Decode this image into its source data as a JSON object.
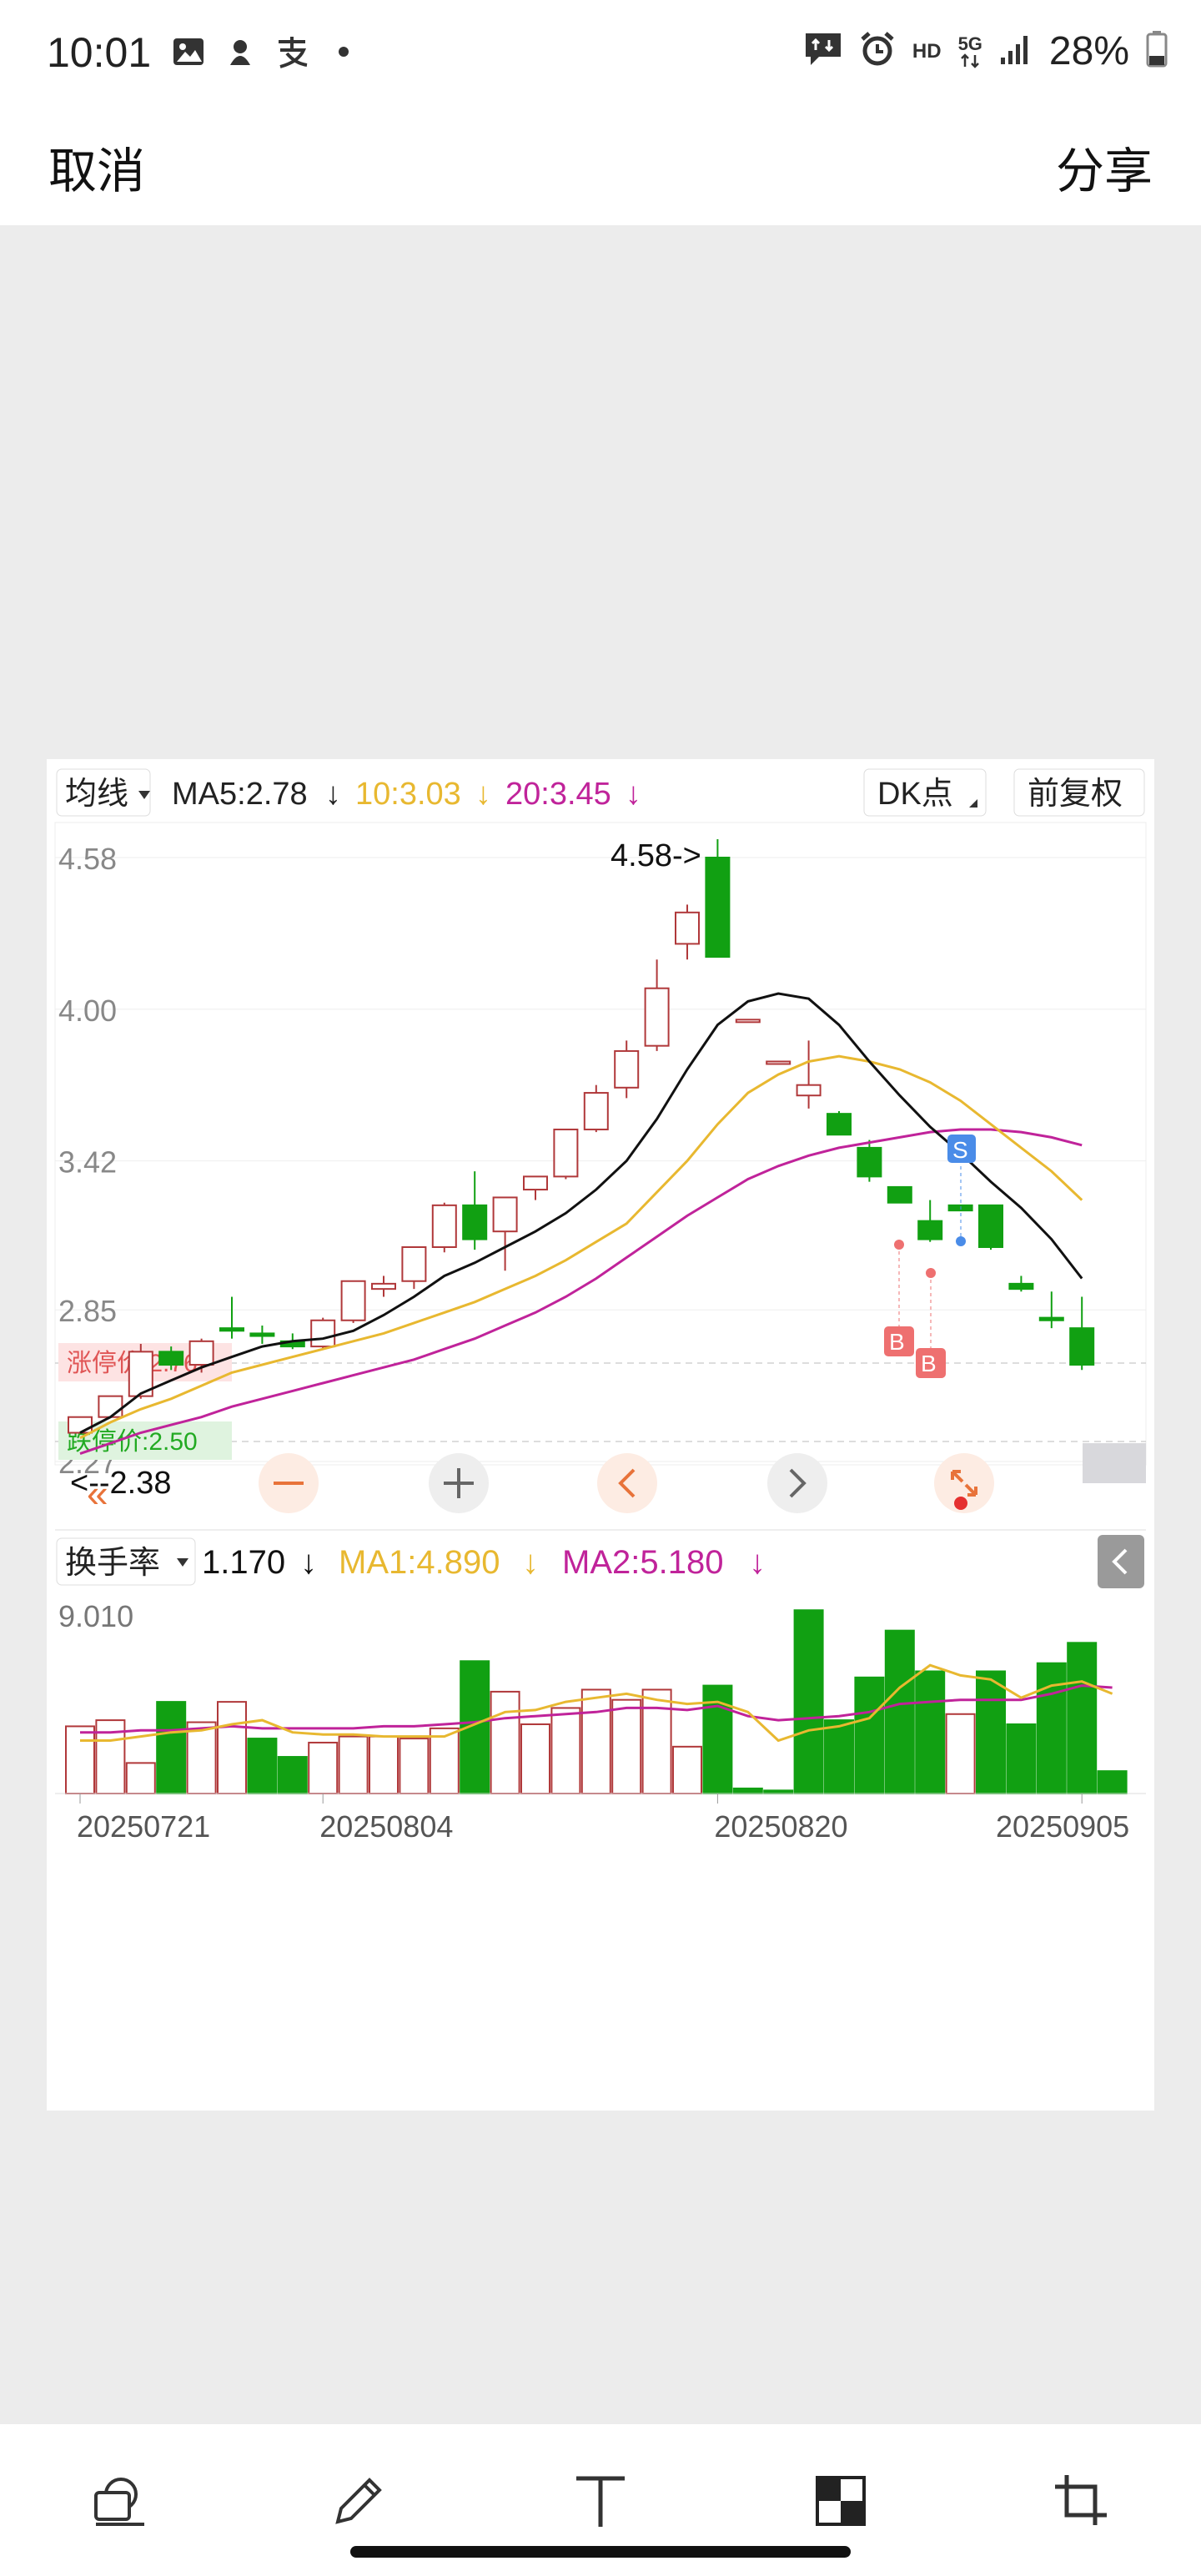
{
  "status_bar": {
    "time": "10:01",
    "network": "5G",
    "hd": "HD",
    "battery": "28%",
    "icons": [
      "gallery-icon",
      "app-icon",
      "alipay-icon",
      "dot-icon",
      "message-icon",
      "alarm-icon",
      "signal-icon",
      "battery-icon"
    ]
  },
  "header": {
    "cancel_label": "取消",
    "share_label": "分享"
  },
  "chart": {
    "indicator_bar": {
      "type_label": "均线",
      "ma5": "MA5:2.78",
      "ma10": "10:3.03",
      "ma20": "20:3.45",
      "arrow": "↓",
      "dk_label": "DK点",
      "adj_label": "前复权"
    },
    "price_labels": [
      "4.58",
      "4.00",
      "3.42",
      "2.85",
      "2.27"
    ],
    "high_marker": "4.58->",
    "low_marker": "<--2.38",
    "limit_up": "涨停价:2.76",
    "limit_down": "跌停价:2.50",
    "marker_s": "S",
    "marker_b": "B",
    "volume_bar": {
      "type_label": "换手率",
      "value": "1.170",
      "ma1": "MA1:4.890",
      "ma2": "MA2:5.180",
      "arrow": "↓"
    },
    "vol_max_label": "9.010",
    "date_labels": [
      "20250721",
      "20250804",
      "20250820",
      "20250905"
    ],
    "colors": {
      "up": "#b0383a",
      "down": "#11a012",
      "ma5": "#111111",
      "ma10": "#e8b830",
      "ma20": "#c0239a",
      "limit_up": "#e05555",
      "limit_down": "#22aa22",
      "nav": "#e8733a",
      "marker_s": "#4a8ce8",
      "marker_b": "#ee7070"
    }
  },
  "chart_data": {
    "type": "candlestick",
    "price_axis": [
      2.27,
      4.58
    ],
    "dates": [
      "20250721",
      "20250804",
      "20250820",
      "20250905"
    ],
    "candles": [
      {
        "o": 2.38,
        "h": 2.44,
        "l": 2.38,
        "c": 2.44
      },
      {
        "o": 2.44,
        "h": 2.52,
        "l": 2.44,
        "c": 2.52
      },
      {
        "o": 2.52,
        "h": 2.72,
        "l": 2.51,
        "c": 2.69
      },
      {
        "o": 2.69,
        "h": 2.71,
        "l": 2.62,
        "c": 2.64
      },
      {
        "o": 2.64,
        "h": 2.74,
        "l": 2.61,
        "c": 2.73
      },
      {
        "o": 2.78,
        "h": 2.9,
        "l": 2.74,
        "c": 2.77
      },
      {
        "o": 2.76,
        "h": 2.79,
        "l": 2.72,
        "c": 2.75
      },
      {
        "o": 2.73,
        "h": 2.76,
        "l": 2.7,
        "c": 2.71
      },
      {
        "o": 2.71,
        "h": 2.82,
        "l": 2.7,
        "c": 2.81
      },
      {
        "o": 2.81,
        "h": 2.96,
        "l": 2.8,
        "c": 2.96
      },
      {
        "o": 2.93,
        "h": 2.98,
        "l": 2.9,
        "c": 2.95
      },
      {
        "o": 2.96,
        "h": 3.09,
        "l": 2.93,
        "c": 3.09
      },
      {
        "o": 3.09,
        "h": 3.26,
        "l": 3.07,
        "c": 3.25
      },
      {
        "o": 3.25,
        "h": 3.38,
        "l": 3.08,
        "c": 3.12
      },
      {
        "o": 3.15,
        "h": 3.28,
        "l": 3.0,
        "c": 3.28
      },
      {
        "o": 3.31,
        "h": 3.36,
        "l": 3.27,
        "c": 3.36
      },
      {
        "o": 3.36,
        "h": 3.54,
        "l": 3.35,
        "c": 3.54
      },
      {
        "o": 3.54,
        "h": 3.71,
        "l": 3.53,
        "c": 3.68
      },
      {
        "o": 3.7,
        "h": 3.88,
        "l": 3.66,
        "c": 3.84
      },
      {
        "o": 3.86,
        "h": 4.19,
        "l": 3.84,
        "c": 4.08
      },
      {
        "o": 4.25,
        "h": 4.4,
        "l": 4.19,
        "c": 4.37
      },
      {
        "o": 4.58,
        "h": 4.65,
        "l": 4.2,
        "c": 4.2
      },
      {
        "o": 3.96,
        "h": 3.96,
        "l": 3.96,
        "c": 3.96
      },
      {
        "o": 3.8,
        "h": 3.8,
        "l": 3.79,
        "c": 3.8
      },
      {
        "o": 3.67,
        "h": 3.88,
        "l": 3.62,
        "c": 3.71
      },
      {
        "o": 3.6,
        "h": 3.61,
        "l": 3.52,
        "c": 3.52
      },
      {
        "o": 3.47,
        "h": 3.5,
        "l": 3.34,
        "c": 3.36
      },
      {
        "o": 3.32,
        "h": 3.32,
        "l": 3.26,
        "c": 3.26
      },
      {
        "o": 3.19,
        "h": 3.27,
        "l": 3.11,
        "c": 3.12
      },
      {
        "o": 3.25,
        "h": 3.25,
        "l": 3.23,
        "c": 3.23
      },
      {
        "o": 3.25,
        "h": 3.25,
        "l": 3.08,
        "c": 3.09
      },
      {
        "o": 2.95,
        "h": 2.98,
        "l": 2.92,
        "c": 2.93
      },
      {
        "o": 2.82,
        "h": 2.92,
        "l": 2.78,
        "c": 2.81
      },
      {
        "o": 2.78,
        "h": 2.9,
        "l": 2.62,
        "c": 2.64
      }
    ],
    "ma5": [
      2.38,
      2.44,
      2.53,
      2.58,
      2.63,
      2.67,
      2.71,
      2.73,
      2.74,
      2.77,
      2.83,
      2.9,
      2.98,
      3.03,
      3.09,
      3.15,
      3.22,
      3.31,
      3.42,
      3.58,
      3.77,
      3.94,
      4.03,
      4.06,
      4.04,
      3.94,
      3.8,
      3.67,
      3.55,
      3.45,
      3.34,
      3.24,
      3.12,
      2.97
    ],
    "ma10": [
      2.36,
      2.42,
      2.47,
      2.51,
      2.56,
      2.61,
      2.64,
      2.67,
      2.7,
      2.73,
      2.76,
      2.8,
      2.84,
      2.88,
      2.93,
      2.98,
      3.04,
      3.11,
      3.18,
      3.3,
      3.42,
      3.56,
      3.68,
      3.75,
      3.8,
      3.82,
      3.8,
      3.77,
      3.72,
      3.65,
      3.56,
      3.47,
      3.38,
      3.27
    ],
    "ma20": [
      2.3,
      2.34,
      2.38,
      2.41,
      2.44,
      2.48,
      2.51,
      2.54,
      2.57,
      2.6,
      2.63,
      2.66,
      2.7,
      2.74,
      2.79,
      2.84,
      2.9,
      2.97,
      3.05,
      3.13,
      3.21,
      3.28,
      3.35,
      3.4,
      3.44,
      3.47,
      3.49,
      3.51,
      3.53,
      3.54,
      3.54,
      3.53,
      3.51,
      3.48
    ],
    "turnover": [
      3.3,
      3.6,
      1.5,
      4.5,
      3.5,
      4.5,
      2.7,
      1.8,
      2.5,
      2.8,
      2.8,
      2.7,
      3.2,
      6.5,
      5.0,
      3.4,
      4.2,
      5.1,
      4.6,
      5.1,
      2.3,
      5.3,
      0.25,
      0.15,
      9.0,
      3.6,
      5.7,
      8.0,
      6.0,
      3.9,
      6.0,
      3.4,
      6.4,
      7.4,
      1.1
    ],
    "turnover_up": [
      true,
      true,
      true,
      false,
      true,
      true,
      false,
      false,
      true,
      true,
      true,
      true,
      true,
      false,
      true,
      true,
      true,
      true,
      true,
      true,
      true,
      false,
      false,
      false,
      false,
      false,
      false,
      false,
      false,
      true,
      false,
      false,
      false,
      false,
      false
    ],
    "turnover_ma1": [
      2.6,
      2.6,
      2.8,
      3.0,
      3.1,
      3.4,
      3.6,
      3.0,
      2.9,
      2.9,
      2.8,
      2.8,
      2.8,
      3.4,
      4.0,
      4.1,
      4.5,
      4.7,
      4.9,
      4.6,
      4.4,
      4.5,
      4.0,
      2.6,
      3.1,
      3.3,
      3.7,
      5.2,
      6.3,
      5.8,
      5.6,
      4.7,
      5.3,
      5.5,
      4.9
    ],
    "turnover_ma2": [
      3.0,
      3.0,
      3.1,
      3.1,
      3.2,
      3.3,
      3.2,
      3.2,
      3.2,
      3.2,
      3.3,
      3.3,
      3.4,
      3.5,
      3.7,
      3.8,
      3.9,
      4.0,
      4.2,
      4.2,
      4.1,
      4.3,
      3.8,
      3.6,
      3.7,
      3.8,
      4.0,
      4.4,
      4.5,
      4.6,
      4.6,
      4.6,
      4.9,
      5.3,
      5.2
    ],
    "volume_axis_max": 9.01
  },
  "toolbar": {
    "tools": [
      "erase-icon",
      "pen-icon",
      "text-icon",
      "mosaic-icon",
      "crop-icon"
    ]
  }
}
